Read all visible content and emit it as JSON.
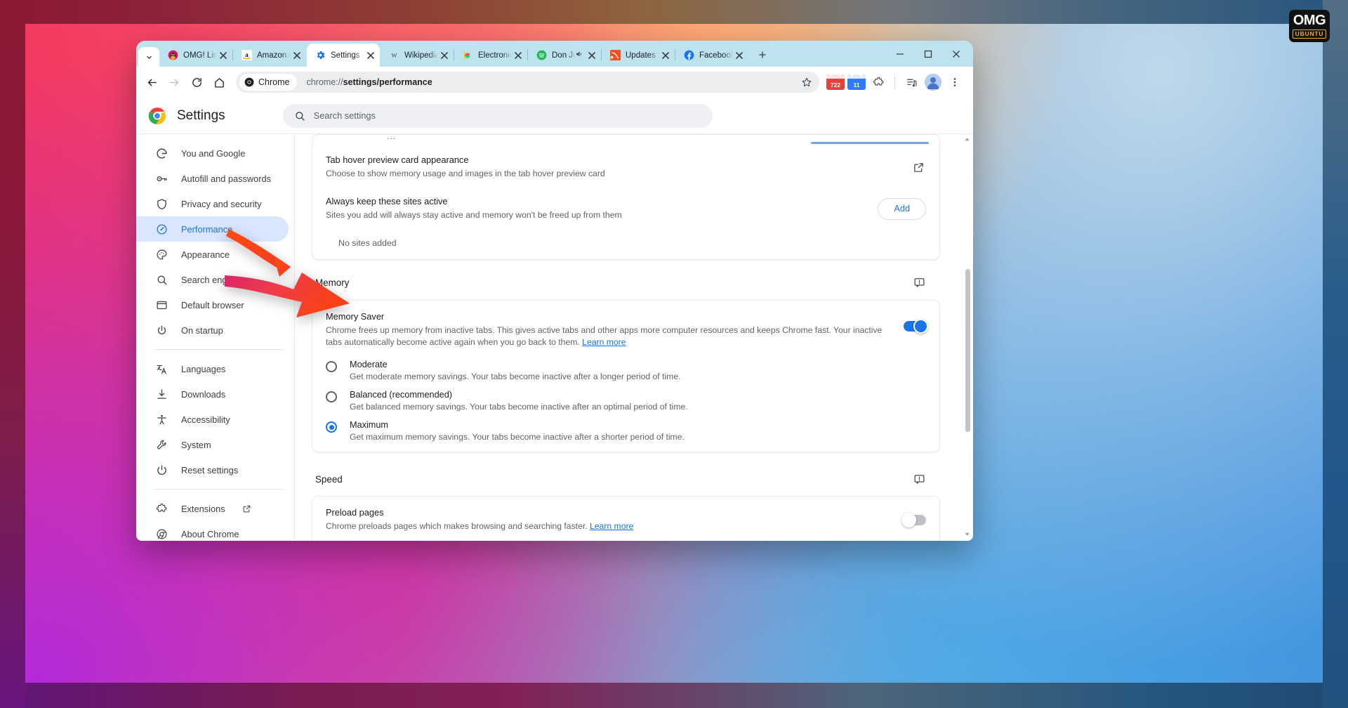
{
  "branding": {
    "logo_omg": "OMG",
    "logo_ubuntu": "UBUNTU"
  },
  "window": {
    "minimize_label": "Minimize",
    "maximize_label": "Maximize",
    "close_label": "Close"
  },
  "tabstrip": {
    "tab_search_name": "tab-search-icon",
    "new_tab_label": "+",
    "tabs": [
      {
        "title": "OMG! Linux",
        "favicon": "omg-linux-icon",
        "active": false,
        "audio": false
      },
      {
        "title": "Amazon.com",
        "favicon": "amazon-icon",
        "active": false,
        "audio": false
      },
      {
        "title": "Settings -",
        "favicon": "chrome-settings-gear-icon",
        "active": true,
        "audio": false
      },
      {
        "title": "Wikipedia",
        "favicon": "wikipedia-icon",
        "active": false,
        "audio": false
      },
      {
        "title": "Electronics",
        "favicon": "google-play-icon",
        "active": false,
        "audio": false
      },
      {
        "title": "Don Ju",
        "favicon": "spotify-icon",
        "active": false,
        "audio": true
      },
      {
        "title": "Updates :",
        "favicon": "updates-icon",
        "active": false,
        "audio": false
      },
      {
        "title": "Facebook",
        "favicon": "facebook-icon",
        "active": false,
        "audio": false
      }
    ]
  },
  "toolbar": {
    "back_label": "Back",
    "forward_label": "Forward",
    "reload_label": "Reload",
    "home_label": "Home",
    "chip_label": "Chrome",
    "url_prefix": "chrome://",
    "url_bold": "settings/performance",
    "url_full": "chrome://settings/performance",
    "bookmark_label": "Bookmark this tab",
    "badge_red_count": "722",
    "badge_blue_count": "11",
    "extensions_label": "Extensions",
    "media_label": "Media controls",
    "profile_label": "Profile",
    "menu_label": "Customize and control Google Chrome"
  },
  "settings": {
    "title": "Settings",
    "search": {
      "placeholder": "Search settings",
      "value": "",
      "icon": "search-icon"
    },
    "sidebar": {
      "groups": [
        {
          "items": [
            {
              "label": "You and Google",
              "icon": "google-g-icon",
              "selected": false
            },
            {
              "label": "Autofill and passwords",
              "icon": "key-icon",
              "selected": false
            },
            {
              "label": "Privacy and security",
              "icon": "shield-icon",
              "selected": false
            },
            {
              "label": "Performance",
              "icon": "speedometer-icon",
              "selected": true
            },
            {
              "label": "Appearance",
              "icon": "palette-icon",
              "selected": false
            },
            {
              "label": "Search engine",
              "icon": "search-icon",
              "selected": false
            },
            {
              "label": "Default browser",
              "icon": "browser-window-icon",
              "selected": false
            },
            {
              "label": "On startup",
              "icon": "power-icon",
              "selected": false
            }
          ]
        },
        {
          "items": [
            {
              "label": "Languages",
              "icon": "translate-icon",
              "selected": false
            },
            {
              "label": "Downloads",
              "icon": "download-icon",
              "selected": false
            },
            {
              "label": "Accessibility",
              "icon": "accessibility-icon",
              "selected": false
            },
            {
              "label": "System",
              "icon": "wrench-icon",
              "selected": false
            },
            {
              "label": "Reset settings",
              "icon": "reset-icon",
              "selected": false
            }
          ]
        },
        {
          "items": [
            {
              "label": "Extensions",
              "icon": "extension-icon",
              "selected": false,
              "external": true
            },
            {
              "label": "About Chrome",
              "icon": "chrome-outline-icon",
              "selected": false
            }
          ]
        }
      ]
    },
    "content": {
      "partial_card_ellipsis": "...",
      "tab_hover": {
        "title": "Tab hover preview card appearance",
        "subtitle": "Choose to show memory usage and images in the tab hover preview card",
        "action_icon": "open-in-new-icon"
      },
      "always_active": {
        "title": "Always keep these sites active",
        "subtitle": "Sites you add will always stay active and memory won't be freed up from them",
        "add_label": "Add",
        "empty_text": "No sites added"
      },
      "memory_section": {
        "heading": "Memory",
        "feedback_icon": "feedback-icon",
        "memory_saver": {
          "title": "Memory Saver",
          "subtitle": "Chrome frees up memory from inactive tabs. This gives active tabs and other apps more computer resources and keeps Chrome fast. Your inactive tabs automatically become active again when you go back to them.",
          "learn_more": "Learn more",
          "toggle_on": true
        },
        "options": [
          {
            "label": "Moderate",
            "description": "Get moderate memory savings. Your tabs become inactive after a longer period of time.",
            "selected": false
          },
          {
            "label": "Balanced (recommended)",
            "description": "Get balanced memory savings. Your tabs become inactive after an optimal period of time.",
            "selected": false
          },
          {
            "label": "Maximum",
            "description": "Get maximum memory savings. Your tabs become inactive after a shorter period of time.",
            "selected": true
          }
        ]
      },
      "speed_section": {
        "heading": "Speed",
        "feedback_icon": "feedback-icon",
        "preload": {
          "title": "Preload pages",
          "subtitle": "Chrome preloads pages which makes browsing and searching faster.",
          "learn_more": "Learn more",
          "toggle_on": false
        }
      }
    }
  },
  "colors": {
    "accent_blue": "#1a73e8",
    "selected_nav_bg": "#d9e6fd",
    "tabstrip_bg": "#bde3ee",
    "arrow_red": "#f23a22",
    "arrow_pink": "#e8336b"
  }
}
